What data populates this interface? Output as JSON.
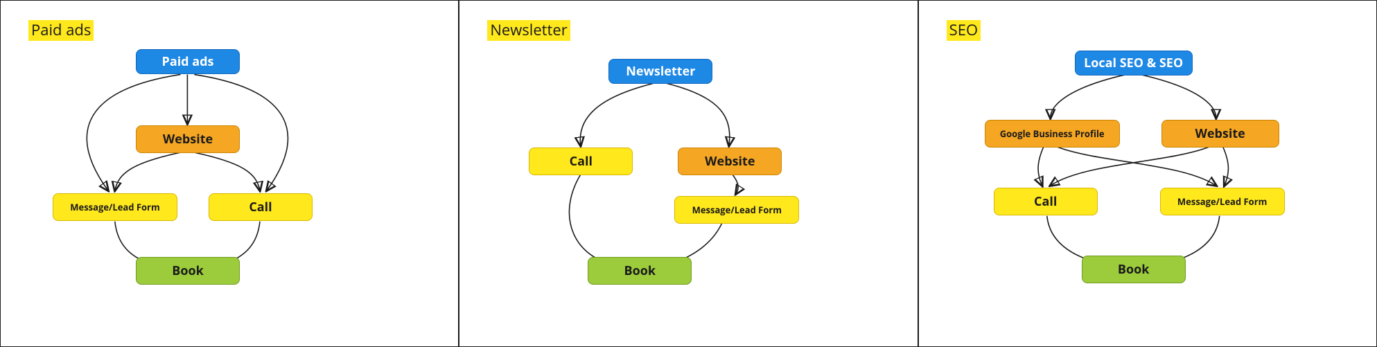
{
  "colors": {
    "blue": "#1e88e5",
    "orange": "#f5a623",
    "yellow": "#ffe81c",
    "green": "#9ccc3c"
  },
  "panels": {
    "paid": {
      "title": "Paid ads",
      "nodes": {
        "root": "Paid ads",
        "website": "Website",
        "message": "Message/Lead Form",
        "call": "Call",
        "book": "Book"
      }
    },
    "newsletter": {
      "title": "Newsletter",
      "nodes": {
        "root": "Newsletter",
        "call": "Call",
        "website": "Website",
        "message": "Message/Lead Form",
        "book": "Book"
      }
    },
    "seo": {
      "title": "SEO",
      "nodes": {
        "root": "Local SEO & SEO",
        "gbp": "Google Business Profile",
        "website": "Website",
        "call": "Call",
        "message": "Message/Lead Form",
        "book": "Book"
      }
    }
  }
}
